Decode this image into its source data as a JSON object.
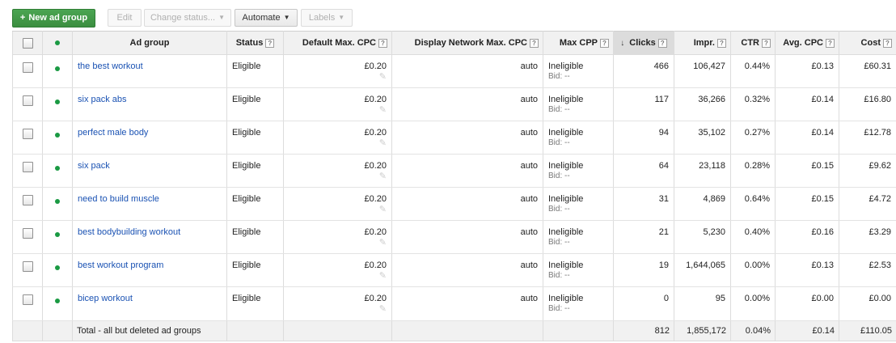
{
  "toolbar": {
    "new_ad_group": "New ad group",
    "edit": "Edit",
    "change_status": "Change status...",
    "automate": "Automate",
    "labels": "Labels"
  },
  "columns": {
    "ad_group": "Ad group",
    "status": "Status",
    "default_max_cpc": "Default Max. CPC",
    "display_network_max_cpc": "Display Network Max. CPC",
    "max_cpp": "Max CPP",
    "clicks": "Clicks",
    "impr": "Impr.",
    "ctr": "CTR",
    "avg_cpc": "Avg. CPC",
    "cost": "Cost"
  },
  "help_glyph": "?",
  "sort_arrow": "↓",
  "rows": [
    {
      "name": "the best workout",
      "status": "Eligible",
      "default_cpc": "£0.20",
      "display_cpc": "auto",
      "max_cpp": "Ineligible",
      "bid": "Bid: --",
      "clicks": "466",
      "impr": "106,427",
      "ctr": "0.44%",
      "avg_cpc": "£0.13",
      "cost": "£60.31"
    },
    {
      "name": "six pack abs",
      "status": "Eligible",
      "default_cpc": "£0.20",
      "display_cpc": "auto",
      "max_cpp": "Ineligible",
      "bid": "Bid: --",
      "clicks": "117",
      "impr": "36,266",
      "ctr": "0.32%",
      "avg_cpc": "£0.14",
      "cost": "£16.80"
    },
    {
      "name": "perfect male body",
      "status": "Eligible",
      "default_cpc": "£0.20",
      "display_cpc": "auto",
      "max_cpp": "Ineligible",
      "bid": "Bid: --",
      "clicks": "94",
      "impr": "35,102",
      "ctr": "0.27%",
      "avg_cpc": "£0.14",
      "cost": "£12.78"
    },
    {
      "name": "six pack",
      "status": "Eligible",
      "default_cpc": "£0.20",
      "display_cpc": "auto",
      "max_cpp": "Ineligible",
      "bid": "Bid: --",
      "clicks": "64",
      "impr": "23,118",
      "ctr": "0.28%",
      "avg_cpc": "£0.15",
      "cost": "£9.62"
    },
    {
      "name": "need to build muscle",
      "status": "Eligible",
      "default_cpc": "£0.20",
      "display_cpc": "auto",
      "max_cpp": "Ineligible",
      "bid": "Bid: --",
      "clicks": "31",
      "impr": "4,869",
      "ctr": "0.64%",
      "avg_cpc": "£0.15",
      "cost": "£4.72"
    },
    {
      "name": "best bodybuilding workout",
      "status": "Eligible",
      "default_cpc": "£0.20",
      "display_cpc": "auto",
      "max_cpp": "Ineligible",
      "bid": "Bid: --",
      "clicks": "21",
      "impr": "5,230",
      "ctr": "0.40%",
      "avg_cpc": "£0.16",
      "cost": "£3.29"
    },
    {
      "name": "best workout program",
      "status": "Eligible",
      "default_cpc": "£0.20",
      "display_cpc": "auto",
      "max_cpp": "Ineligible",
      "bid": "Bid: --",
      "clicks": "19",
      "impr": "1,644,065",
      "ctr": "0.00%",
      "avg_cpc": "£0.13",
      "cost": "£2.53"
    },
    {
      "name": "bicep workout",
      "status": "Eligible",
      "default_cpc": "£0.20",
      "display_cpc": "auto",
      "max_cpp": "Ineligible",
      "bid": "Bid: --",
      "clicks": "0",
      "impr": "95",
      "ctr": "0.00%",
      "avg_cpc": "£0.00",
      "cost": "£0.00"
    }
  ],
  "total": {
    "label": "Total - all but deleted ad groups",
    "clicks": "812",
    "impr": "1,855,172",
    "ctr": "0.04%",
    "avg_cpc": "£0.14",
    "cost": "£110.05"
  },
  "colors": {
    "accent_green": "#3b8e40",
    "link_blue": "#1a52b3",
    "status_dot": "#1a9a43",
    "header_bg": "#f1f1f1",
    "sorted_header_bg": "#dcdcdc"
  },
  "icons": {
    "new_button": "plus-icon",
    "dropdown": "caret-down-icon",
    "edit_cell": "pencil-icon",
    "status": "status-dot-icon",
    "help": "help-icon"
  }
}
